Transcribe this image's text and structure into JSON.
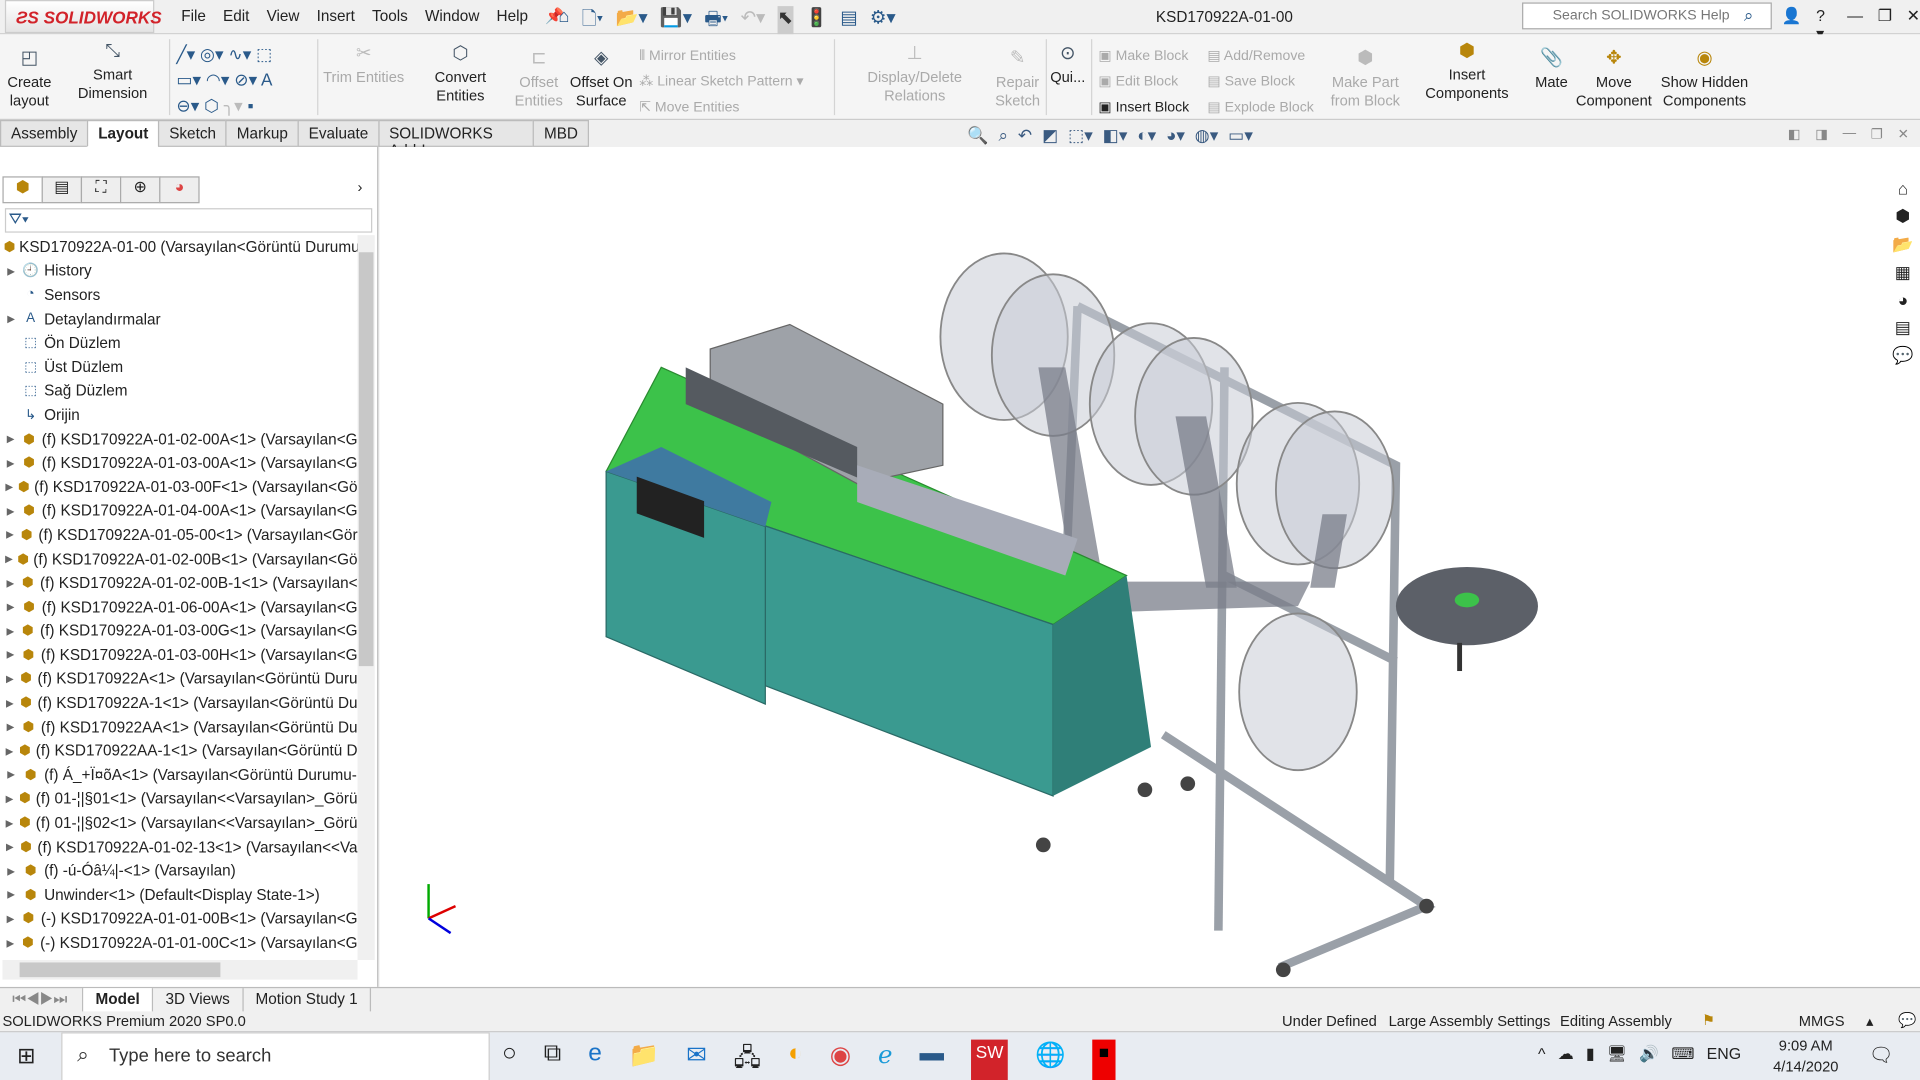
{
  "app": {
    "logo": "SOLIDWORKS",
    "title": "KSD170922A-01-00",
    "search_placeholder": "Search SOLIDWORKS Help"
  },
  "menu": [
    "File",
    "Edit",
    "View",
    "Insert",
    "Tools",
    "Window",
    "Help"
  ],
  "ribbon": {
    "create_layout": "Create layout",
    "smart_dimension": "Smart Dimension",
    "trim_entities": "Trim Entities",
    "convert_entities": "Convert Entities",
    "offset_entities": "Offset Entities",
    "offset_on_surface": "Offset On Surface",
    "mirror_entities": "Mirror Entities",
    "linear_sketch_pattern": "Linear Sketch Pattern",
    "move_entities": "Move Entities",
    "display_delete_relations": "Display/Delete Relations",
    "repair_sketch": "Repair Sketch",
    "quick_snaps": "Qui...",
    "make_block": "Make Block",
    "edit_block": "Edit Block",
    "insert_block": "Insert Block",
    "add_remove": "Add/Remove",
    "save_block": "Save Block",
    "explode_block": "Explode Block",
    "make_part_from_block": "Make Part from Block",
    "insert_components": "Insert Components",
    "mate": "Mate",
    "move_component": "Move Component",
    "show_hidden_components": "Show Hidden Components"
  },
  "tabs": [
    {
      "label": "Assembly"
    },
    {
      "label": "Layout",
      "active": true
    },
    {
      "label": "Sketch"
    },
    {
      "label": "Markup"
    },
    {
      "label": "Evaluate"
    },
    {
      "label": "SOLIDWORKS Add-Ins"
    },
    {
      "label": "MBD"
    }
  ],
  "tree": {
    "root": "KSD170922A-01-00  (Varsayılan<Görüntü Durumu",
    "items": [
      {
        "label": "History",
        "exp": true,
        "icon": "history-icon"
      },
      {
        "label": "Sensors",
        "exp": false,
        "icon": "sensors-icon"
      },
      {
        "label": "Detaylandırmalar",
        "exp": true,
        "icon": "annotations-icon"
      },
      {
        "label": "Ön Düzlem",
        "exp": false,
        "icon": "plane-icon"
      },
      {
        "label": "Üst Düzlem",
        "exp": false,
        "icon": "plane-icon"
      },
      {
        "label": "Sağ Düzlem",
        "exp": false,
        "icon": "plane-icon"
      },
      {
        "label": "Orijin",
        "exp": false,
        "icon": "origin-icon"
      },
      {
        "label": "(f) KSD170922A-01-02-00A<1> (Varsayılan<G",
        "exp": true,
        "icon": "assembly-icon"
      },
      {
        "label": "(f) KSD170922A-01-03-00A<1> (Varsayılan<G",
        "exp": true,
        "icon": "subassembly-icon"
      },
      {
        "label": "(f) KSD170922A-01-03-00F<1> (Varsayılan<Gö",
        "exp": true,
        "icon": "subassembly-icon"
      },
      {
        "label": "(f) KSD170922A-01-04-00A<1> (Varsayılan<G",
        "exp": true,
        "icon": "subassembly-icon"
      },
      {
        "label": "(f) KSD170922A-01-05-00<1> (Varsayılan<Gör",
        "exp": true,
        "icon": "subassembly-icon"
      },
      {
        "label": "(f) KSD170922A-01-02-00B<1> (Varsayılan<Gö",
        "exp": true,
        "icon": "subassembly-icon"
      },
      {
        "label": "(f) KSD170922A-01-02-00B-1<1> (Varsayılan<",
        "exp": true,
        "icon": "subassembly-icon"
      },
      {
        "label": "(f) KSD170922A-01-06-00A<1> (Varsayılan<G",
        "exp": true,
        "icon": "subassembly-icon"
      },
      {
        "label": "(f) KSD170922A-01-03-00G<1> (Varsayılan<G",
        "exp": true,
        "icon": "subassembly-icon"
      },
      {
        "label": "(f) KSD170922A-01-03-00H<1> (Varsayılan<G",
        "exp": true,
        "icon": "subassembly-icon"
      },
      {
        "label": "(f) KSD170922A<1> (Varsayılan<Görüntü Duru",
        "exp": true,
        "icon": "subassembly-icon"
      },
      {
        "label": "(f) KSD170922A-1<1> (Varsayılan<Görüntü Du",
        "exp": true,
        "icon": "subassembly-icon"
      },
      {
        "label": "(f) KSD170922AA<1> (Varsayılan<Görüntü Du",
        "exp": true,
        "icon": "subassembly-icon"
      },
      {
        "label": "(f) KSD170922AA-1<1> (Varsayılan<Görüntü D",
        "exp": true,
        "icon": "subassembly-icon"
      },
      {
        "label": "(f) Á_+Ï¤õA<1> (Varsayılan<Görüntü Durumu-",
        "exp": true,
        "icon": "subassembly-icon"
      },
      {
        "label": "(f) 01-¦|§01<1> (Varsayılan<<Varsayılan>_Görü",
        "exp": true,
        "icon": "subassembly-icon"
      },
      {
        "label": "(f) 01-¦|§02<1> (Varsayılan<<Varsayılan>_Görü",
        "exp": true,
        "icon": "subassembly-icon"
      },
      {
        "label": "(f) KSD170922A-01-02-13<1> (Varsayılan<<Va",
        "exp": true,
        "icon": "subassembly-icon"
      },
      {
        "label": "(f) -ú-Óâ¼|-<1> (Varsayılan)",
        "exp": true,
        "icon": "subassembly-icon"
      },
      {
        "label": "Unwinder<1> (Default<Display State-1>)",
        "exp": true,
        "icon": "assembly-icon"
      },
      {
        "label": "(-) KSD170922A-01-01-00B<1> (Varsayılan<G",
        "exp": true,
        "icon": "subassembly-icon"
      },
      {
        "label": "(-) KSD170922A-01-01-00C<1> (Varsayılan<G",
        "exp": true,
        "icon": "subassembly-icon"
      }
    ]
  },
  "bottom_tabs": [
    {
      "label": "Model",
      "active": true
    },
    {
      "label": "3D Views"
    },
    {
      "label": "Motion Study 1"
    }
  ],
  "status": {
    "version": "SOLIDWORKS Premium 2020 SP0.0",
    "state": "Under Defined",
    "large": "Large Assembly Settings",
    "editing": "Editing Assembly",
    "units": "MMGS"
  },
  "taskbar": {
    "search_placeholder": "Type here to search",
    "lang": "ENG",
    "time": "9:09 AM",
    "date": "4/14/2020"
  },
  "colors": {
    "deck": "#3cc24a",
    "cabinet": "#3a9a90",
    "frame": "#b8bcc4",
    "brand": "#d2232a"
  }
}
